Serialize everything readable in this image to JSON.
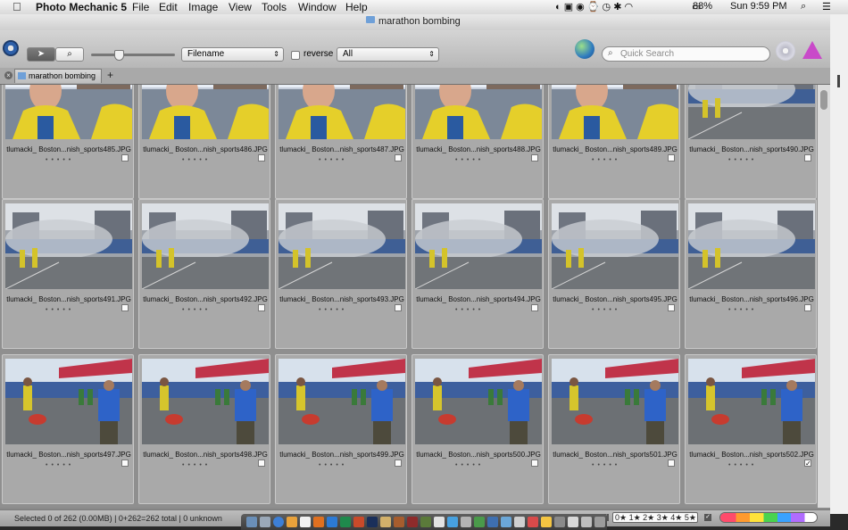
{
  "menubar": {
    "app": "Photo Mechanic 5",
    "menus": [
      "File",
      "Edit",
      "Image",
      "View",
      "Tools",
      "Window",
      "Help"
    ],
    "battery": "88%",
    "clock": "Sun 9:59 PM"
  },
  "window": {
    "title": "marathon bombing"
  },
  "toolbar": {
    "sort_field": "Filename",
    "reverse_label": "reverse",
    "filter_value": "All",
    "search_placeholder": "Quick Search"
  },
  "tab": {
    "label": "marathon bombing",
    "add_label": "+"
  },
  "thumbnails": [
    {
      "name": "tlumacki_ Boston...nish_sports485.JPG",
      "checked": false,
      "scene": "selfie"
    },
    {
      "name": "tlumacki_ Boston...nish_sports486.JPG",
      "checked": false,
      "scene": "selfie"
    },
    {
      "name": "tlumacki_ Boston...nish_sports487.JPG",
      "checked": false,
      "scene": "selfie"
    },
    {
      "name": "tlumacki_ Boston...nish_sports488.JPG",
      "checked": false,
      "scene": "selfie"
    },
    {
      "name": "tlumacki_ Boston...nish_sports489.JPG",
      "checked": false,
      "scene": "selfie"
    },
    {
      "name": "tlumacki_ Boston...nish_sports490.JPG",
      "checked": false,
      "scene": "smoke"
    },
    {
      "name": "tlumacki_ Boston...nish_sports491.JPG",
      "checked": false,
      "scene": "smoke"
    },
    {
      "name": "tlumacki_ Boston...nish_sports492.JPG",
      "checked": false,
      "scene": "smoke"
    },
    {
      "name": "tlumacki_ Boston...nish_sports493.JPG",
      "checked": false,
      "scene": "smoke"
    },
    {
      "name": "tlumacki_ Boston...nish_sports494.JPG",
      "checked": false,
      "scene": "smoke"
    },
    {
      "name": "tlumacki_ Boston...nish_sports495.JPG",
      "checked": false,
      "scene": "smoke"
    },
    {
      "name": "tlumacki_ Boston...nish_sports496.JPG",
      "checked": false,
      "scene": "smoke"
    },
    {
      "name": "tlumacki_ Boston...nish_sports497.JPG",
      "checked": false,
      "scene": "street"
    },
    {
      "name": "tlumacki_ Boston...nish_sports498.JPG",
      "checked": false,
      "scene": "street"
    },
    {
      "name": "tlumacki_ Boston...nish_sports499.JPG",
      "checked": false,
      "scene": "street"
    },
    {
      "name": "tlumacki_ Boston...nish_sports500.JPG",
      "checked": false,
      "scene": "street"
    },
    {
      "name": "tlumacki_ Boston...nish_sports501.JPG",
      "checked": false,
      "scene": "street"
    },
    {
      "name": "tlumacki_ Boston...nish_sports502.JPG",
      "checked": true,
      "scene": "street"
    }
  ],
  "statusbar": {
    "summary": "Selected 0 of 262 (0.00MB) | 0+262=262 total | 0 unknown",
    "stars": "0★ 1★ 2★ 3★ 4★ 5★"
  },
  "colors": {
    "accent": "#3b7fd6",
    "cell_bg": "#a9a9a9",
    "grid_bg": "#8f8f8f"
  }
}
